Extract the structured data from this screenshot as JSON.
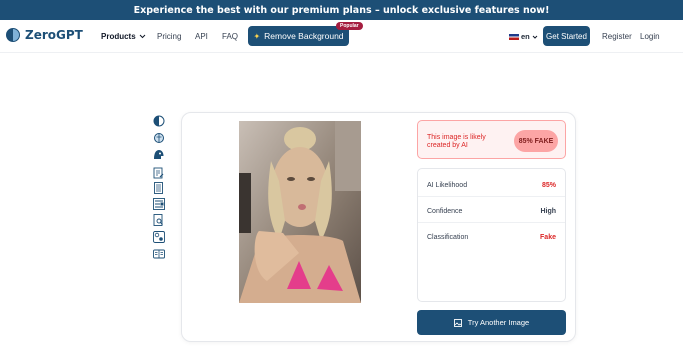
{
  "banner": {
    "text": "Experience the best with our premium plans – unlock exclusive features now!"
  },
  "brand": {
    "name": "ZeroGPT",
    "logo_icon": "zerogpt-logo-icon",
    "color": "#1d4f76"
  },
  "nav": {
    "products": "Products",
    "pricing": "Pricing",
    "api": "API",
    "faq": "FAQ",
    "remove_bg": "Remove Background",
    "popular_badge": "Popular",
    "language": "en",
    "get_started": "Get Started",
    "register": "Register",
    "login": "Login"
  },
  "tools": [
    {
      "icon": "half-circle-icon"
    },
    {
      "icon": "brain-icon"
    },
    {
      "icon": "robot-head-icon"
    },
    {
      "icon": "document-edit-icon"
    },
    {
      "icon": "document-lines-icon"
    },
    {
      "icon": "grammar-check-icon"
    },
    {
      "icon": "document-search-icon"
    },
    {
      "icon": "translate-icon"
    },
    {
      "icon": "book-icon"
    }
  ],
  "result": {
    "verdict_text": "This image is likely created by AI",
    "verdict_pill": "85% FAKE",
    "rows": [
      {
        "label": "AI Likelihood",
        "value": "85%",
        "color": "#dc2626"
      },
      {
        "label": "Confidence",
        "value": "High",
        "color": "#374151"
      },
      {
        "label": "Classification",
        "value": "Fake",
        "color": "#dc2626"
      }
    ],
    "try_another": "Try Another Image"
  }
}
